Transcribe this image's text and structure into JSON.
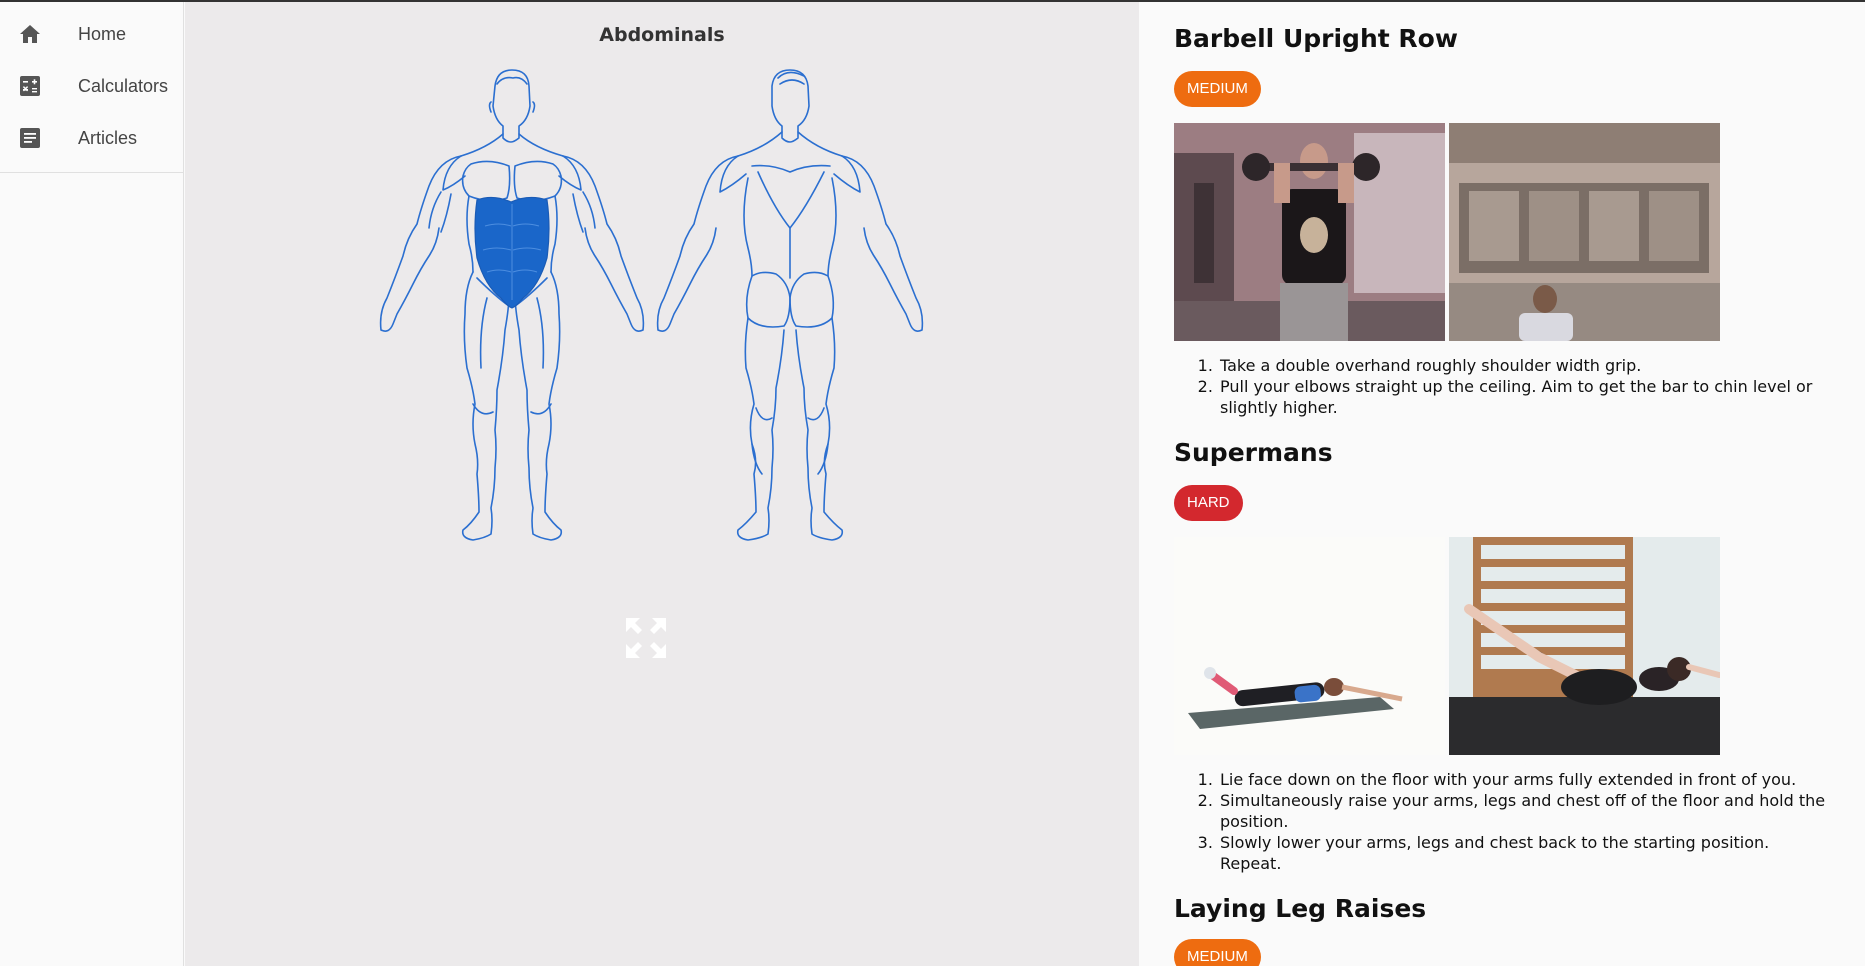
{
  "sidebar": {
    "items": [
      {
        "label": "Home",
        "icon": "home-icon"
      },
      {
        "label": "Calculators",
        "icon": "calculator-icon"
      },
      {
        "label": "Articles",
        "icon": "article-icon"
      }
    ]
  },
  "body_map": {
    "title": "Abdominals",
    "highlighted_muscle": "abdominals",
    "highlight_color": "#1a66c9",
    "outline_color": "#2b6fd0"
  },
  "exercises": [
    {
      "name": "Barbell Upright Row",
      "difficulty": "MEDIUM",
      "steps": [
        "Take a double overhand roughly shoulder width grip.",
        "Pull your elbows straight up the ceiling. Aim to get the bar to chin level or slightly higher."
      ]
    },
    {
      "name": "Supermans",
      "difficulty": "HARD",
      "steps": [
        "Lie face down on the floor with your arms fully extended in front of you.",
        "Simultaneously raise your arms, legs and chest off of the floor and hold the position.",
        "Slowly lower your arms, legs and chest back to the starting position. Repeat."
      ]
    },
    {
      "name": "Laying Leg Raises",
      "difficulty": "MEDIUM",
      "steps": []
    }
  ],
  "colors": {
    "medium": "#ee6c10",
    "hard": "#d3282e"
  }
}
